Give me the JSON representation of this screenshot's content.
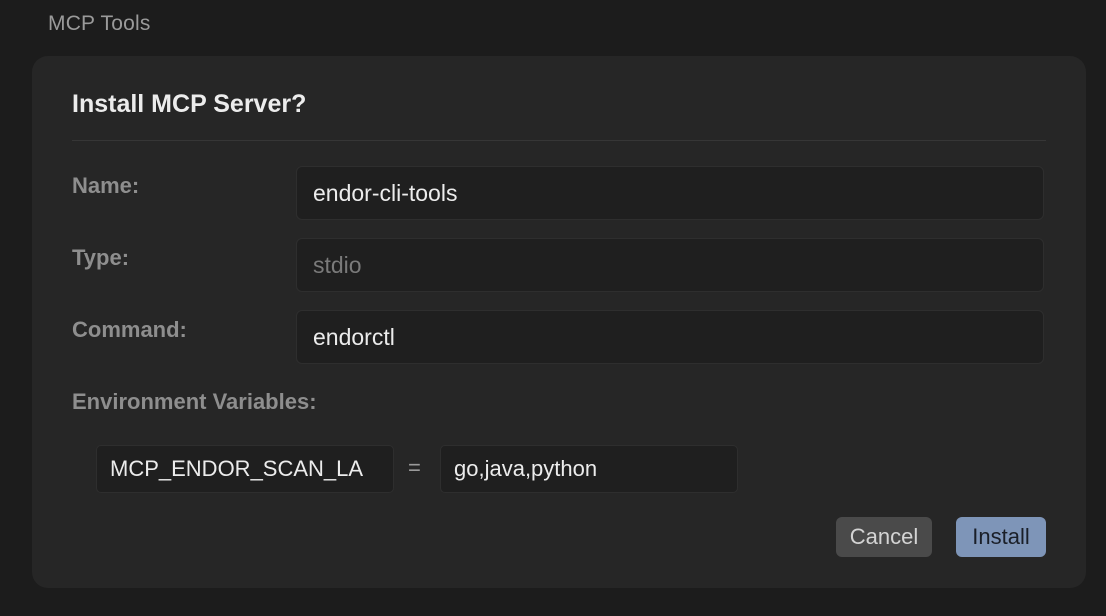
{
  "section": {
    "title": "MCP Tools"
  },
  "dialog": {
    "title": "Install MCP Server?",
    "name": {
      "label": "Name:",
      "value": "endor-cli-tools"
    },
    "type": {
      "label": "Type:",
      "value": "stdio"
    },
    "command": {
      "label": "Command:",
      "value": "endorctl"
    },
    "env": {
      "label": "Environment Variables:",
      "items": [
        {
          "key": "MCP_ENDOR_SCAN_LA",
          "separator": "=",
          "value": "go,java,python"
        }
      ]
    },
    "buttons": {
      "cancel": "Cancel",
      "install": "Install"
    }
  },
  "colors": {
    "background": "#1c1c1c",
    "dialog": "#262626",
    "primary_button": "#7e95b8",
    "secondary_button": "#4a4a4a"
  }
}
